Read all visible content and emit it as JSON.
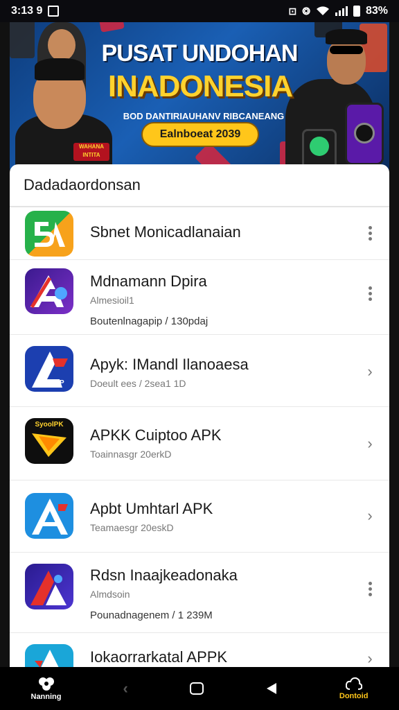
{
  "status": {
    "time": "3:13 9",
    "battery": "83%"
  },
  "banner": {
    "title": "PUSAT UNDOHAN",
    "subtitle": "INADONESIA",
    "tagline": "BOD DANTIRIAUHANV RIBCANEANG",
    "button_label": "Ealnboeat 2039",
    "badge_label": "WAHANA INTITA",
    "colors": {
      "accent": "#ffc61a",
      "background": "#1a5fb4"
    }
  },
  "section": {
    "title": "Dadadaordonsan"
  },
  "apps": [
    {
      "name": "Sbnet Monicadlanaian",
      "meta": "",
      "meta2": "",
      "action": "more",
      "icon": "app-icon-green"
    },
    {
      "name": "Mdnamann Dpira",
      "meta": "Almesioil1",
      "meta2": "Boutenlnagapip / 130pdaj",
      "action": "more",
      "icon": "app-icon-purple"
    },
    {
      "name": "Apyk: IMandl Ilanoaesa",
      "meta": "Doeult ees / 2sea1 1D",
      "meta2": "",
      "action": "chevron",
      "icon": "app-icon-blue-red"
    },
    {
      "name": "APKK Cuiptoo APK",
      "meta": "Toainnasgr 20erkD",
      "meta2": "",
      "action": "chevron",
      "icon": "app-icon-black-yellow",
      "icon_label": "SyoolPK"
    },
    {
      "name": "Apbt Umhtarl APK",
      "meta": "Teamaesgr 20eskD",
      "meta2": "",
      "action": "chevron",
      "icon": "app-icon-light-blue"
    },
    {
      "name": "Rdsn Inaajkeadonaka",
      "meta": "Almdsoin",
      "meta2": "Pounadnagenem / 1 239M",
      "action": "more",
      "icon": "app-icon-indigo"
    },
    {
      "name": "Iokaorrarkatal APPK",
      "meta": "",
      "meta2": "",
      "action": "chevron",
      "icon": "app-icon-teal"
    }
  ],
  "nav": {
    "left_label": "Nanning",
    "right_label": "Dontoid",
    "icons": [
      "home-icon",
      "back-icon",
      "recents-icon",
      "back-triangle-icon",
      "download-icon"
    ]
  }
}
